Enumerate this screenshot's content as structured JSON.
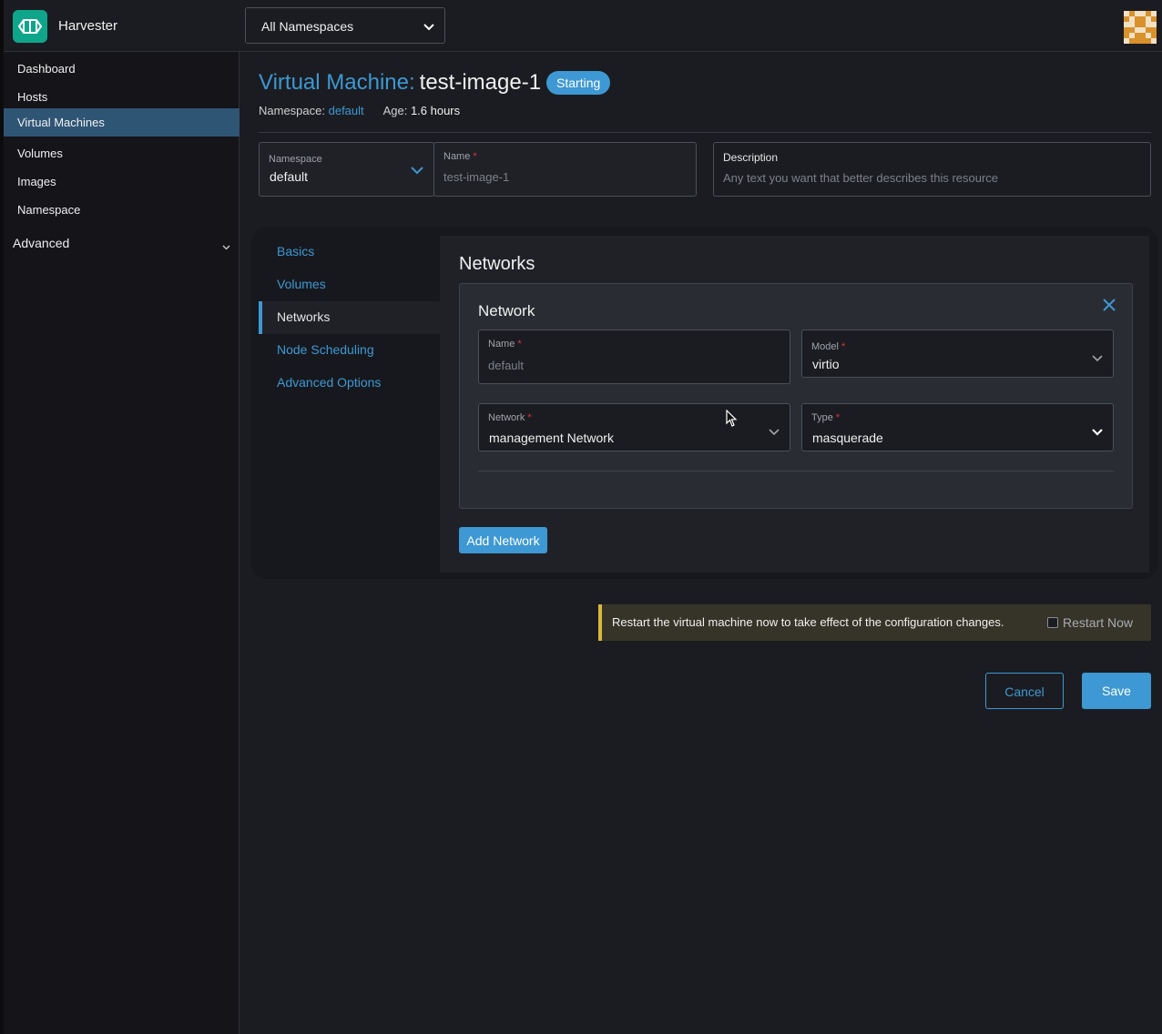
{
  "app": {
    "title": "Harvester",
    "namespace_filter": "All Namespaces"
  },
  "sidebar": {
    "items": [
      {
        "label": "Dashboard",
        "active": false
      },
      {
        "label": "Hosts",
        "active": false
      },
      {
        "label": "Virtual Machines",
        "active": true
      },
      {
        "label": "Volumes",
        "active": false
      },
      {
        "label": "Images",
        "active": false
      },
      {
        "label": "Namespace",
        "active": false
      }
    ],
    "group": {
      "label": "Advanced",
      "icon": "chevron-down-icon"
    }
  },
  "header": {
    "prefix": "Virtual Machine:",
    "name": "test-image-1",
    "status": "Starting",
    "namespace_label": "Namespace:",
    "namespace_value": "default",
    "age_label": "Age:",
    "age_value": "1.6 hours"
  },
  "form": {
    "namespace": {
      "label": "Namespace",
      "value": "default"
    },
    "name": {
      "label": "Name",
      "required": "*",
      "value": "test-image-1"
    },
    "description": {
      "label": "Description",
      "placeholder": "Any text you want that better describes this resource"
    }
  },
  "tabs": [
    {
      "label": "Basics",
      "active": false
    },
    {
      "label": "Volumes",
      "active": false
    },
    {
      "label": "Networks",
      "active": true
    },
    {
      "label": "Node Scheduling",
      "active": false
    },
    {
      "label": "Advanced Options",
      "active": false
    }
  ],
  "networks": {
    "title": "Networks",
    "card_title": "Network",
    "name": {
      "label": "Name",
      "required": "*",
      "value": "default"
    },
    "model": {
      "label": "Model",
      "required": "*",
      "value": "virtio"
    },
    "network": {
      "label": "Network",
      "required": "*",
      "value": "management Network"
    },
    "type": {
      "label": "Type",
      "required": "*",
      "value": "masquerade"
    },
    "add_button": "Add Network"
  },
  "banner": {
    "text": "Restart the virtual machine now to take effect of the configuration changes.",
    "checkbox_label": "Restart Now",
    "checked": false
  },
  "footer": {
    "cancel_label": "Cancel",
    "save_label": "Save"
  },
  "colors": {
    "accent": "#3d98d3",
    "brand": "#0fa58a",
    "warning": "#d9b83b",
    "active_nav": "#2f5575"
  }
}
